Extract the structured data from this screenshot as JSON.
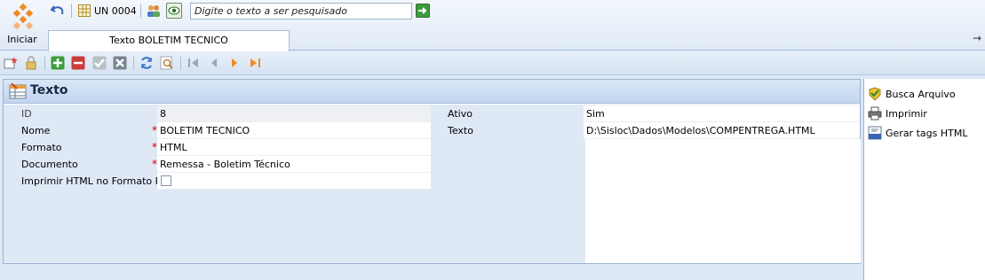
{
  "start": {
    "label": "Iniciar",
    "icon": "start-logo-icon"
  },
  "quick_toolbar": {
    "unit_label": "UN 0004",
    "search_placeholder": "Digite o texto a ser pesquisado",
    "icons": [
      "undo-icon",
      "grid-icon",
      "users-icon",
      "eye-icon",
      "go-arrow-icon"
    ]
  },
  "tab": {
    "label": "Texto BOLETIM TECNICO"
  },
  "toolbar": {
    "icons": [
      "new-record-icon",
      "lock-icon",
      "add-icon",
      "remove-icon",
      "confirm-icon",
      "cancel-icon",
      "refresh-icon",
      "search-record-icon",
      "first-record-icon",
      "previous-record-icon",
      "next-record-icon",
      "last-record-icon"
    ]
  },
  "panel": {
    "title": "Texto",
    "fields": {
      "id_label": "ID",
      "id_value": "8",
      "nome_label": "Nome",
      "nome_value": "BOLETIM TECNICO",
      "formato_label": "Formato",
      "formato_value": "HTML",
      "documento_label": "Documento",
      "documento_value": "Remessa - Boletim Técnico",
      "pdf_label": "Imprimir HTML no Formato PDF",
      "pdf_checked": false,
      "ativo_label": "Ativo",
      "ativo_value": "Sim",
      "texto_label": "Texto",
      "texto_value": "D:\\Sisloc\\Dados\\Modelos\\COMPENTREGA.HTML"
    },
    "required_mark": "*"
  },
  "sidebar": {
    "items": [
      {
        "label": "Busca Arquivo",
        "icon": "search-file-icon"
      },
      {
        "label": "Imprimir",
        "icon": "printer-icon"
      },
      {
        "label": "Gerar tags HTML",
        "icon": "html-tags-icon"
      }
    ]
  },
  "colors": {
    "background": "#dde8f6",
    "required": "#cc0000",
    "accent_orange": "#f08a24",
    "add_green": "#3e9e3e",
    "remove_red": "#cc3b3b"
  }
}
